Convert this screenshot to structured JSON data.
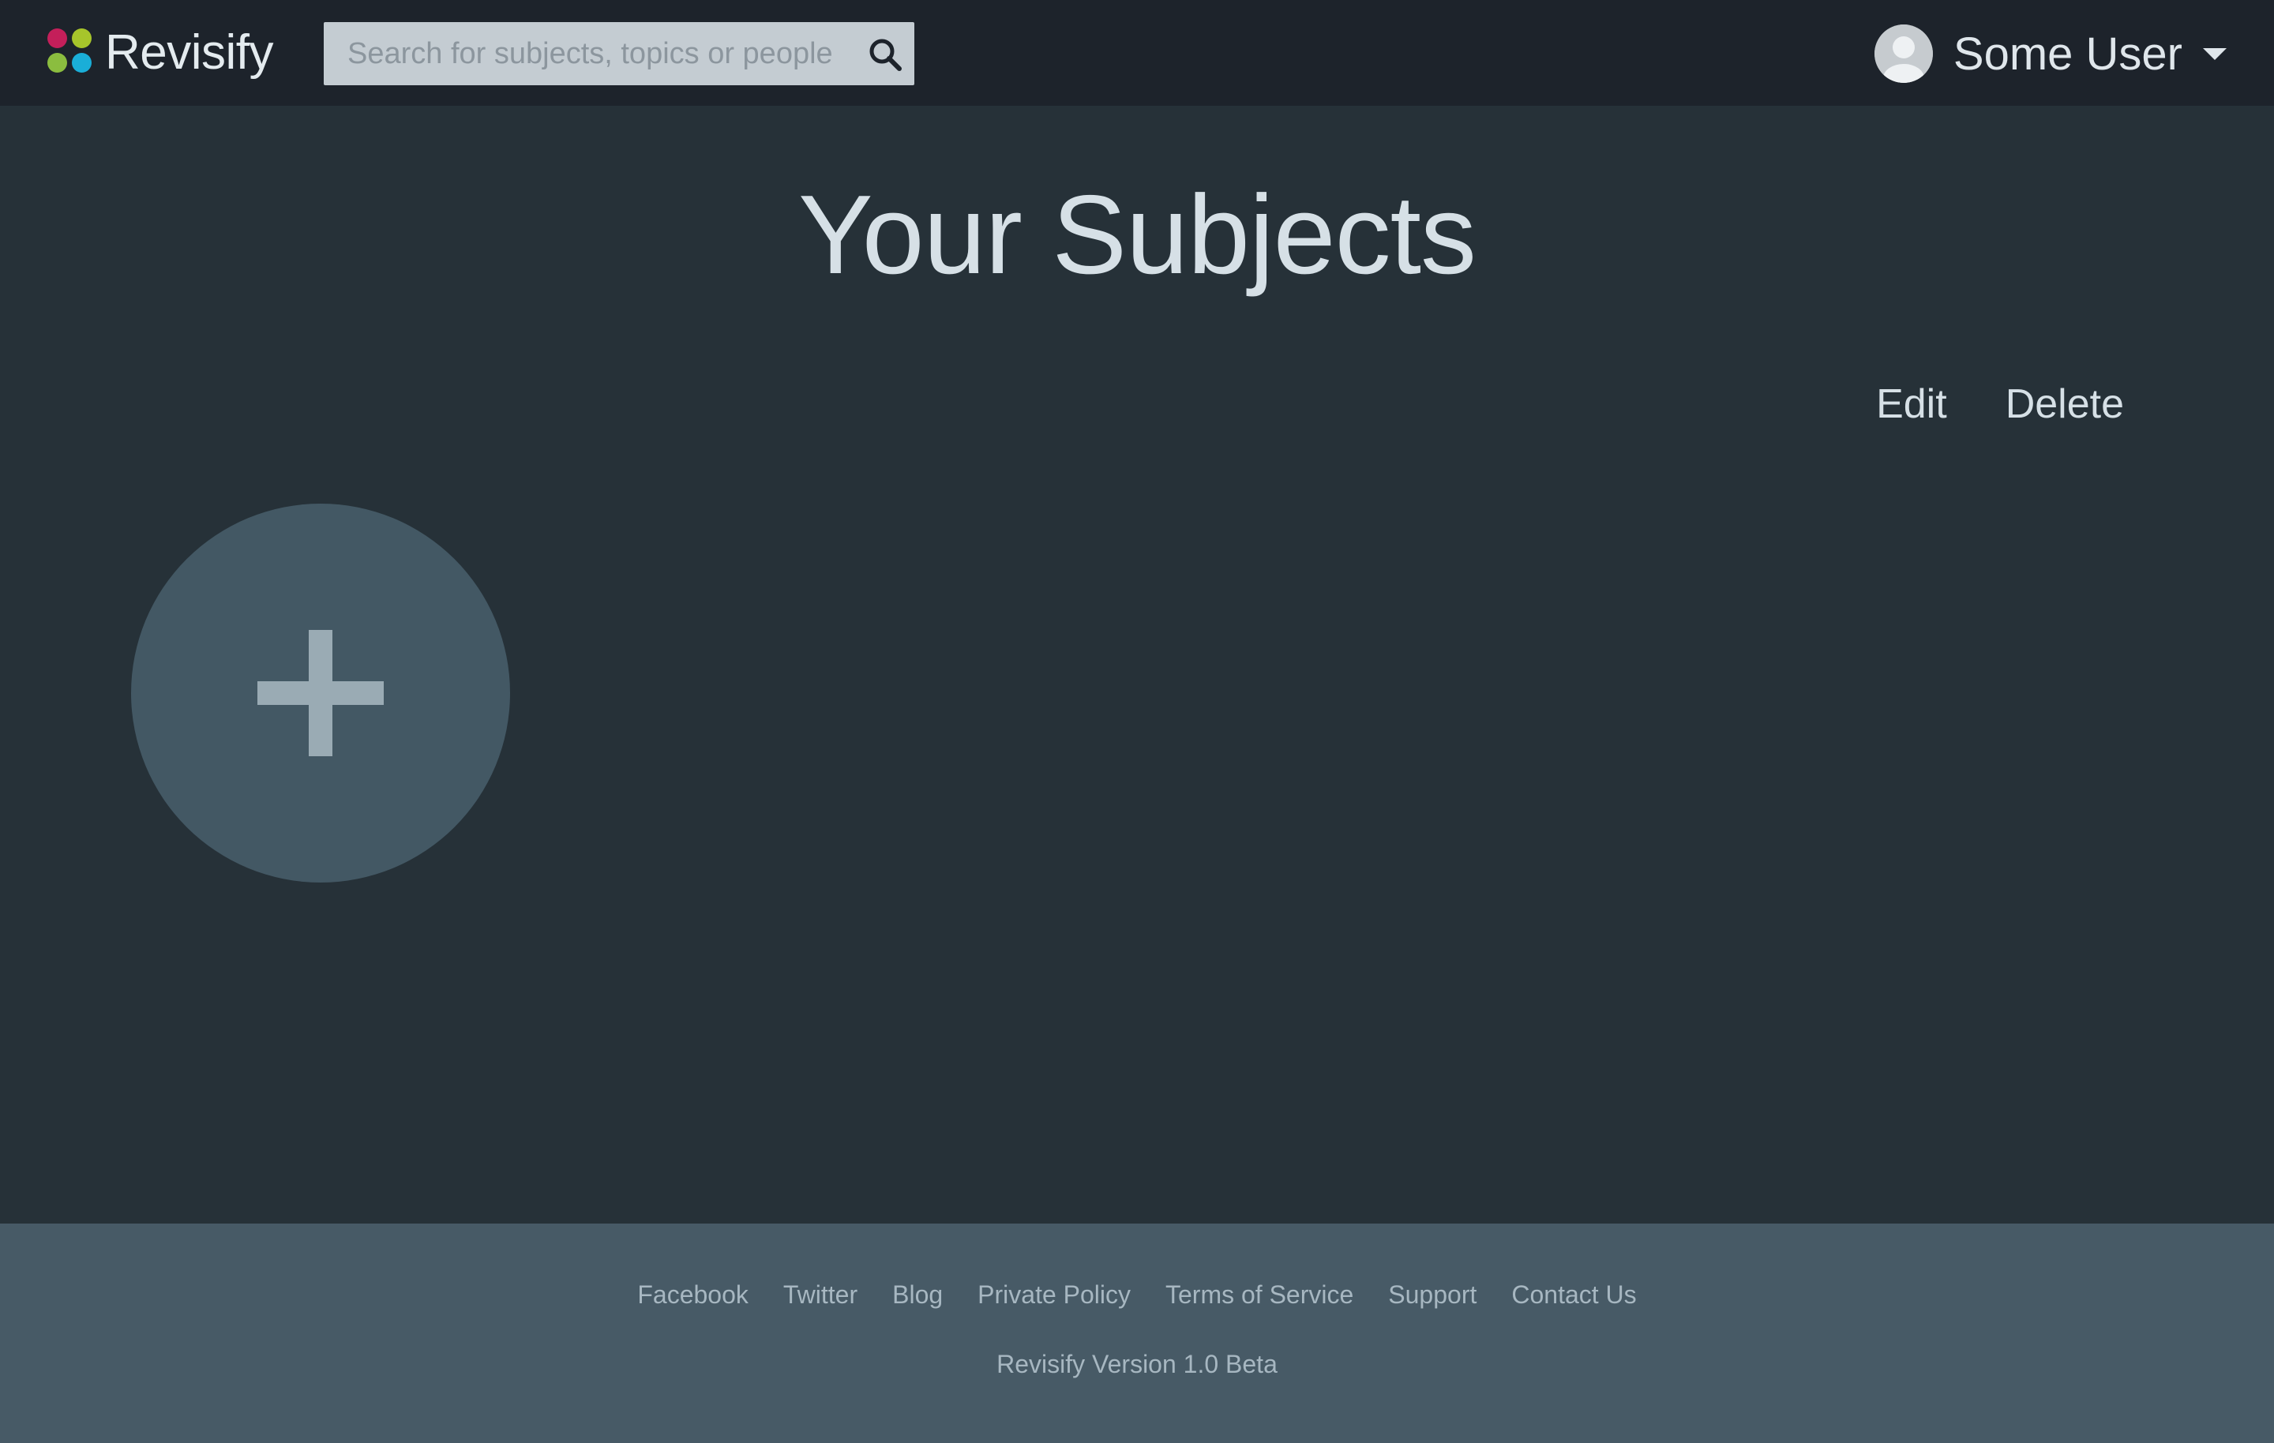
{
  "colors": {
    "topbar_bg": "#1d232b",
    "page_bg": "#263138",
    "footer_bg": "#475a66",
    "add_circle": "#435864",
    "logo_dot_1": "#c41f5a",
    "logo_dot_2": "#a7c52b",
    "logo_dot_3": "#8bbd3f",
    "logo_dot_4": "#1aaed8"
  },
  "header": {
    "brand": "Revisify",
    "logo_icon": "four-dot-logo-icon",
    "search": {
      "placeholder": "Search for subjects, topics or people",
      "value": "",
      "icon": "search-icon"
    },
    "user": {
      "name": "Some User",
      "avatar_icon": "user-avatar-icon",
      "dropdown_icon": "caret-down-icon"
    }
  },
  "main": {
    "title": "Your Subjects",
    "actions": {
      "edit_label": "Edit",
      "delete_label": "Delete"
    },
    "add_subject_icon": "plus-icon"
  },
  "footer": {
    "links": [
      "Facebook",
      "Twitter",
      "Blog",
      "Private Policy",
      "Terms of Service",
      "Support",
      "Contact Us"
    ],
    "version": "Revisify Version 1.0 Beta"
  }
}
